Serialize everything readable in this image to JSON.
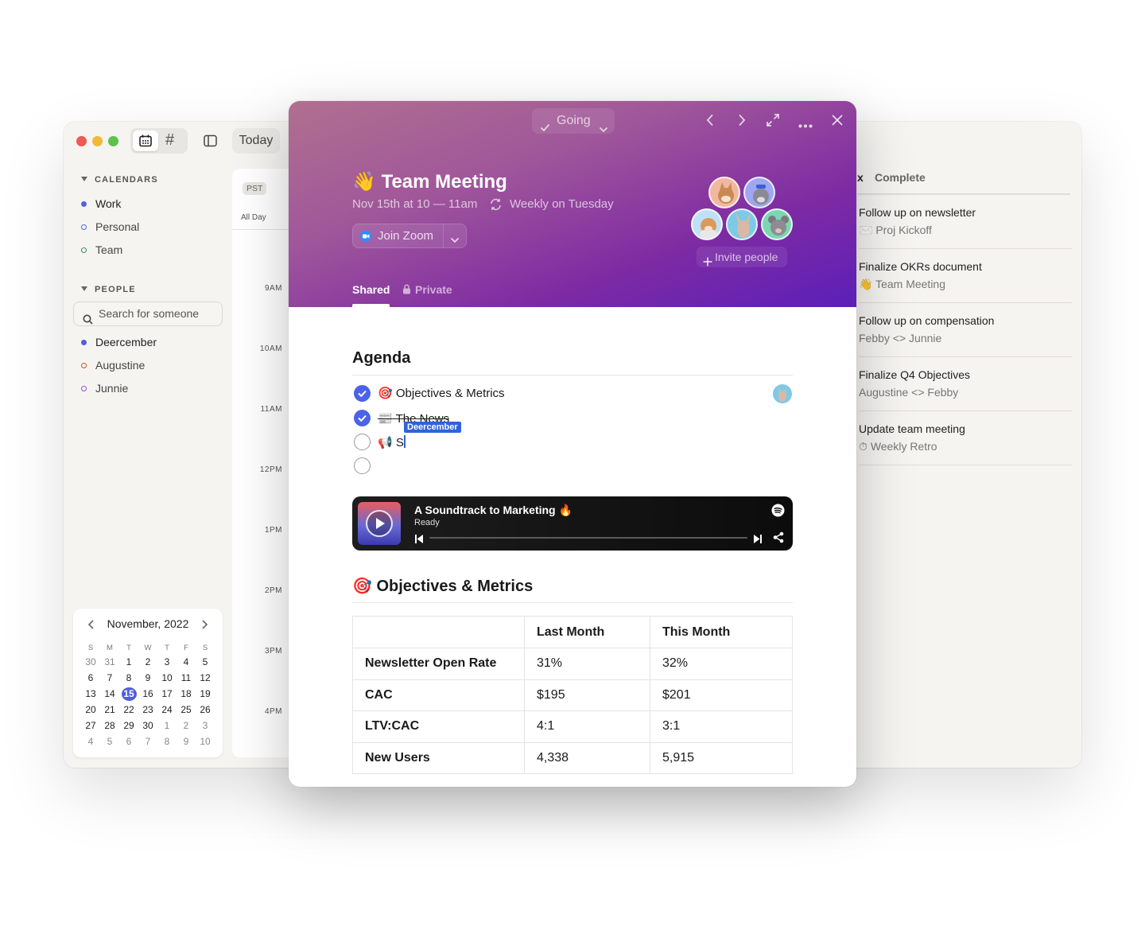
{
  "app": {
    "toolbar": {
      "today_label": "Today"
    },
    "sidebar": {
      "calendars_heading": "CALENDARS",
      "calendars": [
        {
          "label": "Work",
          "color": "#5464d8",
          "filled": true
        },
        {
          "label": "Personal",
          "color": "#5464d8",
          "filled": false
        },
        {
          "label": "Team",
          "color": "#2f8f66",
          "filled": false
        }
      ],
      "people_heading": "PEOPLE",
      "search_placeholder": "Search for someone",
      "people": [
        {
          "label": "Deercember",
          "color": "#4f5ddf",
          "filled": true
        },
        {
          "label": "Augustine",
          "color": "#d94a2f",
          "filled": false
        },
        {
          "label": "Junnie",
          "color": "#9a4ed6",
          "filled": false
        }
      ]
    },
    "mini_calendar": {
      "month_label": "November, 2022",
      "weekdays": [
        "S",
        "M",
        "T",
        "W",
        "T",
        "F",
        "S"
      ],
      "days": [
        "30",
        "31",
        "1",
        "2",
        "3",
        "4",
        "5",
        "6",
        "7",
        "8",
        "9",
        "10",
        "11",
        "12",
        "13",
        "14",
        "15",
        "16",
        "17",
        "18",
        "19",
        "20",
        "21",
        "22",
        "23",
        "24",
        "25",
        "26",
        "27",
        "28",
        "29",
        "30",
        "1",
        "2",
        "3",
        "4",
        "5",
        "6",
        "7",
        "8",
        "9",
        "10"
      ],
      "selected": "15"
    },
    "day_grid": {
      "timezone": "PST",
      "all_day_label": "All Day",
      "hours": [
        "9AM",
        "10AM",
        "11AM",
        "12PM",
        "1PM",
        "2PM",
        "3PM",
        "4PM"
      ]
    },
    "tasks_panel": {
      "tab_inbox": "x",
      "tab_complete": "Complete",
      "tasks": [
        {
          "title": "Follow up on newsletter",
          "subtitle_icon": "✉️",
          "subtitle": "Proj Kickoff"
        },
        {
          "title": "Finalize OKRs document",
          "subtitle_icon": "👋",
          "subtitle": "Team Meeting"
        },
        {
          "title": "Follow up on compensation",
          "subtitle_icon": "",
          "subtitle": "Febby <> Junnie"
        },
        {
          "title": "Finalize Q4 Objectives",
          "subtitle_icon": "",
          "subtitle": "Augustine <> Febby"
        },
        {
          "title": "Update team meeting",
          "subtitle_icon": "⏱",
          "subtitle": "Weekly Retro"
        }
      ]
    }
  },
  "event": {
    "rsvp_label": "Going",
    "title_emoji": "👋",
    "title": "Team Meeting",
    "when": "Nov 15th at 10 — 11am",
    "recurrence": "Weekly on Tuesday",
    "zoom_label": "Join Zoom",
    "invite_label": "Invite people",
    "tab_shared": "Shared",
    "tab_private": "Private",
    "agenda_heading": "Agenda",
    "agenda_items": [
      {
        "icon": "🎯",
        "text": "Objectives & Metrics",
        "done": true
      },
      {
        "icon": "📰",
        "text": "The News",
        "done": true
      },
      {
        "icon": "📢",
        "text": "S",
        "done": false
      },
      {
        "icon": "",
        "text": "",
        "done": false
      }
    ],
    "cursor_user": "Deercember",
    "player": {
      "title": "A Soundtrack to Marketing 🔥",
      "status": "Ready"
    },
    "section_icon": "🎯",
    "section_heading": "Objectives & Metrics",
    "table": {
      "headers": [
        "",
        "Last Month",
        "This Month"
      ],
      "rows": [
        [
          "Newsletter Open Rate",
          "31%",
          "32%"
        ],
        [
          "CAC",
          "$195",
          "$201"
        ],
        [
          "LTV:CAC",
          "4:1",
          "3:1"
        ],
        [
          "New Users",
          "4,338",
          "5,915"
        ]
      ]
    }
  },
  "colors": {
    "accent": "#4b63e6",
    "hero_start": "#b0708f",
    "hero_end": "#5b1fb8",
    "cursor_tag": "#2f63d9"
  }
}
